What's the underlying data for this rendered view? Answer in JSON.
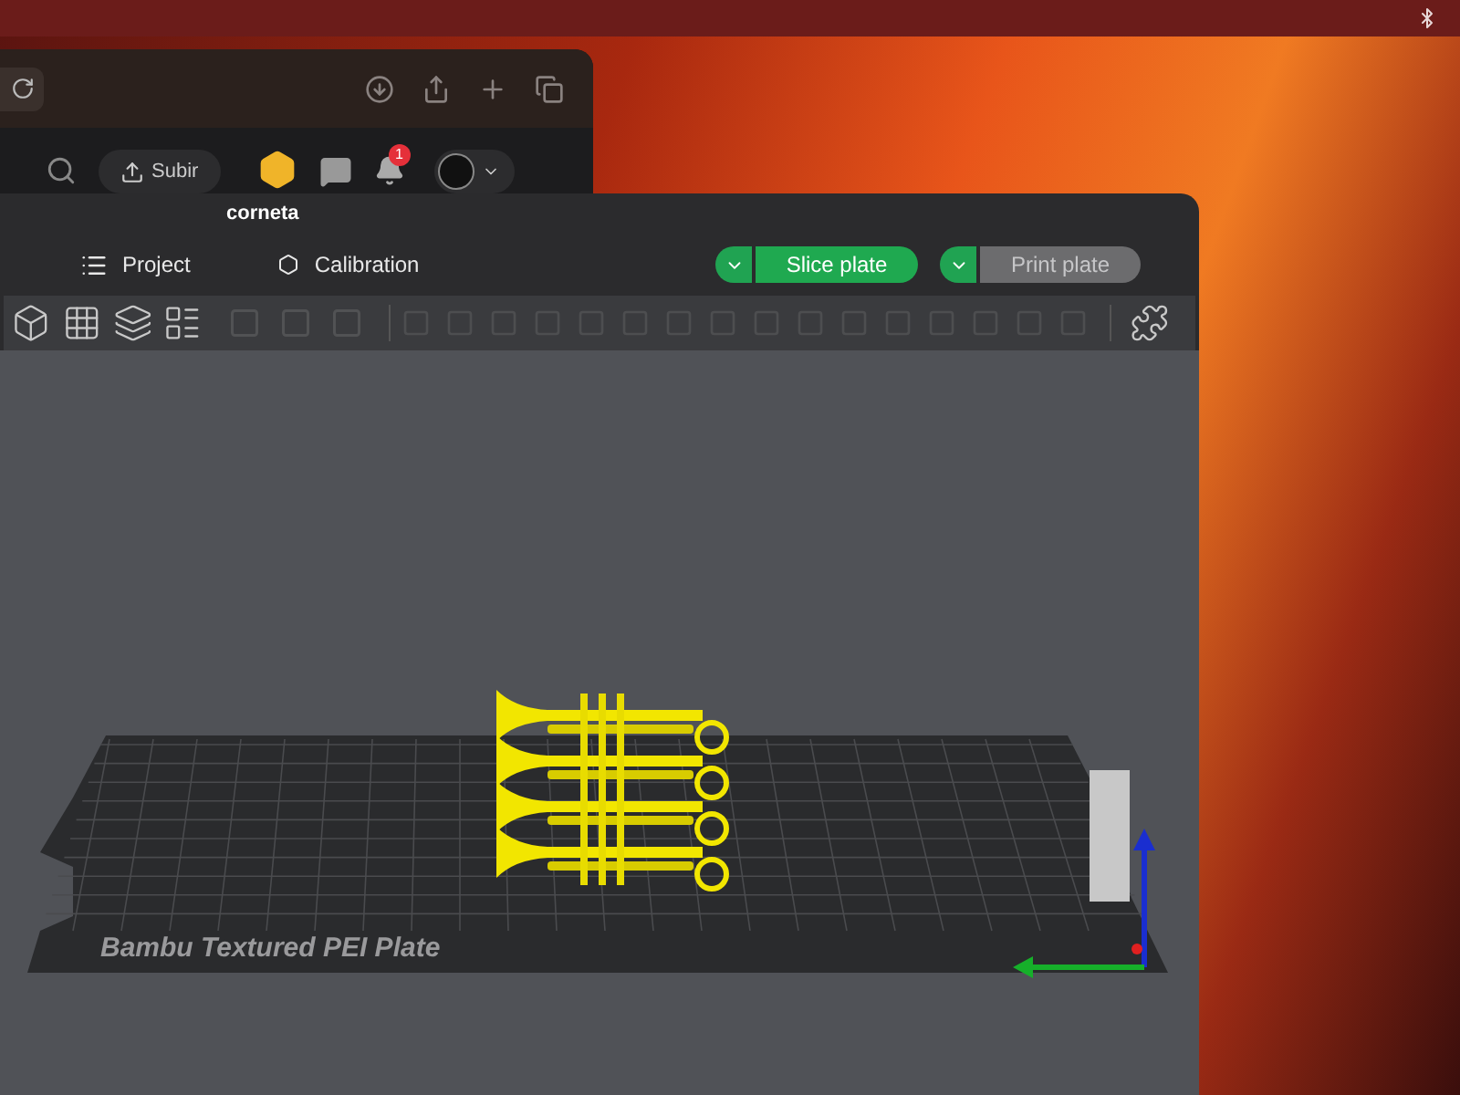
{
  "browser": {
    "upload_button": "Subir",
    "notification_count": "1"
  },
  "slicer": {
    "title": "corneta",
    "tabs": [
      {
        "label": "Project"
      },
      {
        "label": "Calibration"
      }
    ],
    "actions": [
      {
        "label": "Slice plate",
        "disabled": false
      },
      {
        "label": "Print plate",
        "disabled": true
      }
    ],
    "plate": {
      "label": "Bambu Textured PEI Plate"
    }
  }
}
